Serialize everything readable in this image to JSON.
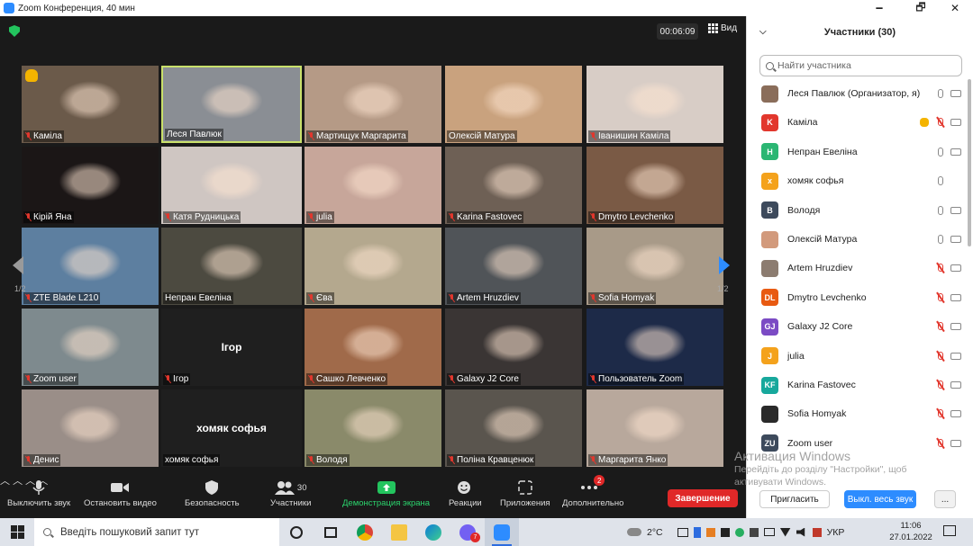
{
  "window": {
    "title": "Zoom Конференция, 40 мин",
    "minimize": "🗕",
    "maximize": "🗗",
    "close": "✕"
  },
  "meeting": {
    "timer": "00:06:09",
    "view_label": "Вид",
    "page_left": "1/2",
    "page_right": "1/2"
  },
  "tiles": [
    {
      "name": "Каміла",
      "muted": true,
      "hand": true,
      "bg": "#6b5a4a"
    },
    {
      "name": "Леся Павлюк",
      "muted": false,
      "active": true,
      "bg": "#8a8e94"
    },
    {
      "name": "Мартищук Маргарита",
      "muted": true,
      "bg": "#b59a86"
    },
    {
      "name": "Олексій Матура",
      "muted": false,
      "bg": "#c9a27e"
    },
    {
      "name": "Іванишин Каміла",
      "muted": true,
      "bg": "#d8cdc6"
    },
    {
      "name": "Кірій Яна",
      "muted": true,
      "bg": "#1b1616"
    },
    {
      "name": "Катя Рудницька",
      "muted": true,
      "bg": "#cfc6c2"
    },
    {
      "name": "julia",
      "muted": true,
      "bg": "#c7a69a"
    },
    {
      "name": "Karina Fastovec",
      "muted": true,
      "bg": "#6e6055"
    },
    {
      "name": "Dmytro Levchenko",
      "muted": true,
      "bg": "#7a5a45"
    },
    {
      "name": "ZTE Blade L210",
      "muted": true,
      "bg": "#5d7fa0"
    },
    {
      "name": "Непран Евеліна",
      "muted": false,
      "bg": "#4c4a40"
    },
    {
      "name": "Єва",
      "muted": true,
      "bg": "#b4a88e"
    },
    {
      "name": "Artem Hruzdiev",
      "muted": true,
      "bg": "#505458"
    },
    {
      "name": "Sofia Homyak",
      "muted": true,
      "bg": "#a89a88"
    },
    {
      "name": "Zoom user",
      "muted": true,
      "bg": "#7e8a8e"
    },
    {
      "name": "Ігор",
      "muted": true,
      "bg": "#1f1f1f",
      "big": "Ігор"
    },
    {
      "name": "Сашко Левченко",
      "muted": true,
      "bg": "#a06a4a"
    },
    {
      "name": "Galaxy J2 Core",
      "muted": true,
      "bg": "#3a3534"
    },
    {
      "name": "Пользователь Zoom",
      "muted": true,
      "bg": "#1d2a48"
    },
    {
      "name": "Денис",
      "muted": true,
      "bg": "#9a8e88"
    },
    {
      "name": "хомяк софья",
      "muted": false,
      "bg": "#1f1f1f",
      "big": "хомяк софья"
    },
    {
      "name": "Володя",
      "muted": true,
      "bg": "#8a8a6a"
    },
    {
      "name": "Поліна Кравценюк",
      "muted": true,
      "bg": "#5a554e"
    },
    {
      "name": "Маргарита Янко",
      "muted": true,
      "bg": "#b8a89c"
    }
  ],
  "toolbar": {
    "mute": "Выключить звук",
    "video": "Остановить видео",
    "security": "Безопасность",
    "participants": "Участники",
    "participants_count": "30",
    "share": "Демонстрация экрана",
    "reactions": "Реакции",
    "apps": "Приложения",
    "more": "Дополнительно",
    "more_badge": "2",
    "end": "Завершение"
  },
  "panel": {
    "title": "Участники (30)",
    "search_placeholder": "Найти участника",
    "participants": [
      {
        "initials": "",
        "name": "Леся Павлюк (Организатор, я)",
        "color": "#8a6d5a",
        "mic": "on",
        "cam": "on"
      },
      {
        "initials": "K",
        "name": "Каміла",
        "color": "#e2372d",
        "mic": "off",
        "cam": "on",
        "hand": true
      },
      {
        "initials": "H",
        "name": "Непран Евеліна",
        "color": "#2bb673",
        "mic": "on",
        "cam": "on"
      },
      {
        "initials": "x",
        "name": "хомяк софья",
        "color": "#f4a21c",
        "mic": "on",
        "cam": "none"
      },
      {
        "initials": "B",
        "name": "Володя",
        "color": "#3d4a5c",
        "mic": "on",
        "cam": "on"
      },
      {
        "initials": "",
        "name": "Олексій Матура",
        "color": "#d29a7c",
        "mic": "on",
        "cam": "on"
      },
      {
        "initials": "",
        "name": "Artem Hruzdiev",
        "color": "#8c7c70",
        "mic": "off",
        "cam": "on"
      },
      {
        "initials": "DL",
        "name": "Dmytro Levchenko",
        "color": "#e85a12",
        "mic": "off",
        "cam": "on"
      },
      {
        "initials": "GJ",
        "name": "Galaxy J2 Core",
        "color": "#7b4bc4",
        "mic": "off",
        "cam": "on"
      },
      {
        "initials": "J",
        "name": "julia",
        "color": "#f4a21c",
        "mic": "off",
        "cam": "on"
      },
      {
        "initials": "KF",
        "name": "Karina Fastovec",
        "color": "#17a89c",
        "mic": "off",
        "cam": "on"
      },
      {
        "initials": "",
        "name": "Sofia Homyak",
        "color": "#2a2a2a",
        "mic": "off",
        "cam": "on"
      },
      {
        "initials": "ZU",
        "name": "Zoom user",
        "color": "#3d4a5c",
        "mic": "off",
        "cam": "on"
      }
    ],
    "invite": "Пригласить",
    "mute_all": "Выкл. весь звук",
    "more": "..."
  },
  "watermark": {
    "line1": "Активация Windows",
    "line2": "Перейдіть до розділу \"Настройки\", щоб",
    "line3": "активувати Windows."
  },
  "taskbar": {
    "search_placeholder": "Введіть пошуковий запит тут",
    "temperature": "2°C",
    "language": "УКР",
    "time": "11:06",
    "date": "27.01.2022",
    "viber_badge": "7"
  }
}
